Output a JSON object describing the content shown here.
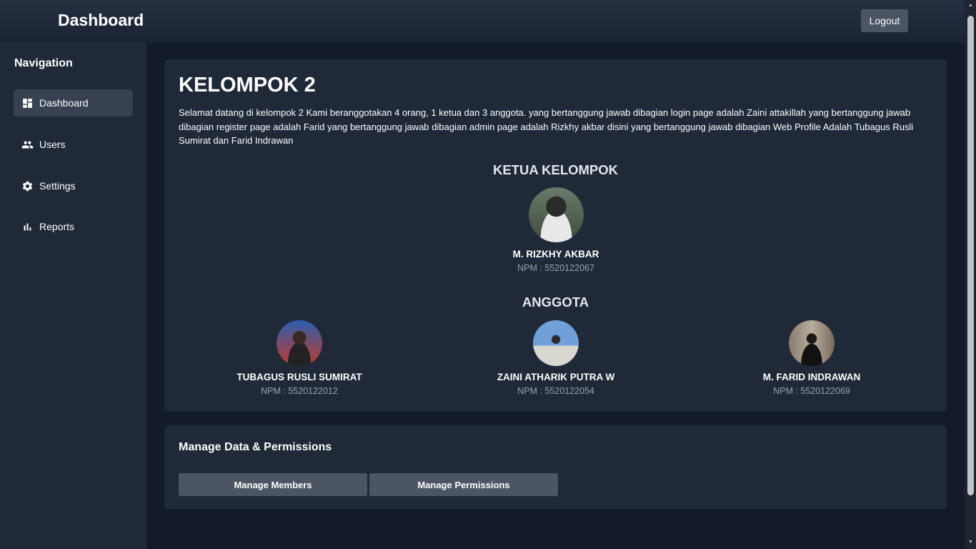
{
  "header": {
    "title": "Dashboard",
    "logout_label": "Logout"
  },
  "sidebar": {
    "heading": "Navigation",
    "items": [
      {
        "label": "Dashboard",
        "icon": "dashboard-icon",
        "active": true
      },
      {
        "label": "Users",
        "icon": "users-icon",
        "active": false
      },
      {
        "label": "Settings",
        "icon": "gear-icon",
        "active": false
      },
      {
        "label": "Reports",
        "icon": "bar-chart-icon",
        "active": false
      }
    ]
  },
  "main": {
    "group_title": "KELOMPOK 2",
    "description": "Selamat datang di kelompok 2 Kami beranggotakan 4 orang, 1 ketua dan 3 anggota. yang bertanggung jawab dibagian login page adalah Zaini attakillah yang bertanggung jawab dibagian register page adalah Farid yang bertanggung jawab dibagian admin page adalah Rizkhy akbar disini yang bertanggung jawab dibagian Web Profile Adalah Tubagus Rusli Sumirat dan Farid Indrawan",
    "leader_heading": "KETUA KELOMPOK",
    "leader": {
      "name": "M. RIZKHY AKBAR",
      "npm": "NPM : 5520122067"
    },
    "members_heading": "ANGGOTA",
    "members": [
      {
        "name": "TUBAGUS RUSLI SUMIRAT",
        "npm": "NPM : 5520122012"
      },
      {
        "name": "ZAINI ATHARIK PUTRA W",
        "npm": "NPM : 5520122054"
      },
      {
        "name": "M. FARID INDRAWAN",
        "npm": "NPM : 5520122069"
      }
    ]
  },
  "manage": {
    "title": "Manage Data & Permissions",
    "members_button": "Manage Members",
    "permissions_button": "Manage Permissions"
  },
  "colors": {
    "background": "#131b2a",
    "panel": "#1f2937",
    "active_nav": "#374151",
    "button": "#4b5563",
    "muted_text": "#9ca3af"
  }
}
